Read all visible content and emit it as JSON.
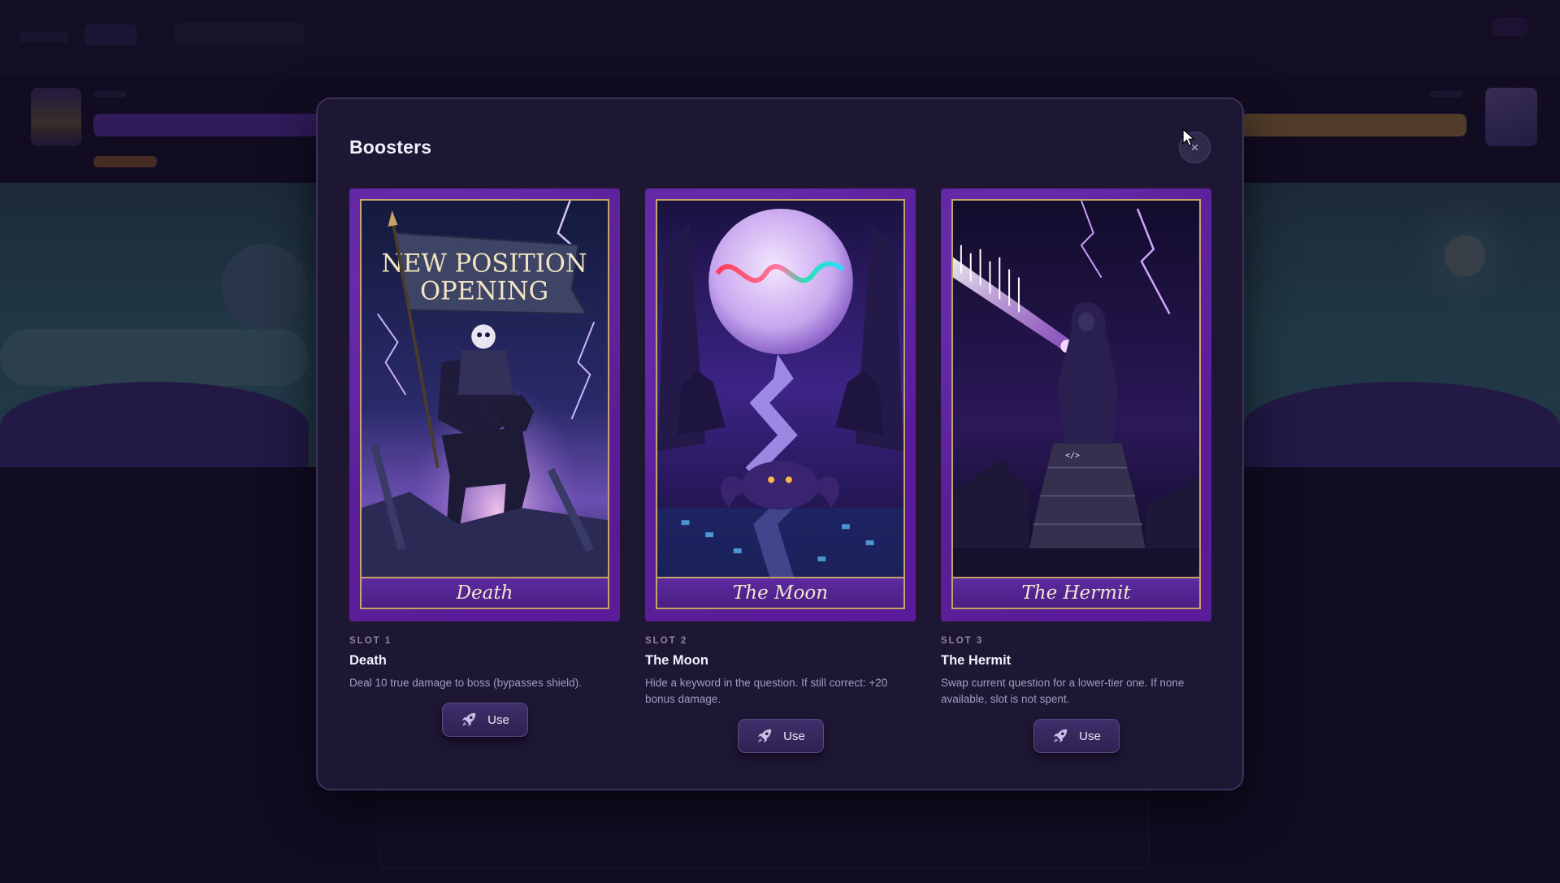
{
  "modal": {
    "title": "Boosters",
    "close_label": "×"
  },
  "boosters": [
    {
      "slot": "SLOT 1",
      "name": "Death",
      "card_caption": "Death",
      "banner_line1": "NEW POSITION",
      "banner_line2": "OPENING",
      "description": "Deal 10 true damage to boss (bypasses shield).",
      "button_label": "Use",
      "button_icon": "rocket-icon"
    },
    {
      "slot": "SLOT 2",
      "name": "The Moon",
      "card_caption": "The Moon",
      "description": "Hide a keyword in the question. If still correct: +20 bonus damage.",
      "button_label": "Use",
      "button_icon": "rocket-icon"
    },
    {
      "slot": "SLOT 3",
      "name": "The Hermit",
      "card_caption": "The Hermit",
      "code_tag": "</>",
      "description": "Swap current question for a lower-tier one. If none available, slot is not spent.",
      "button_label": "Use",
      "button_icon": "rocket-icon"
    }
  ],
  "colors": {
    "modal_bg": "#1d1733",
    "card_frame": "#5a1f99",
    "card_border_gold": "#c8a268",
    "accent_purple": "#8b4fe0",
    "text_muted": "#a39bbd"
  }
}
